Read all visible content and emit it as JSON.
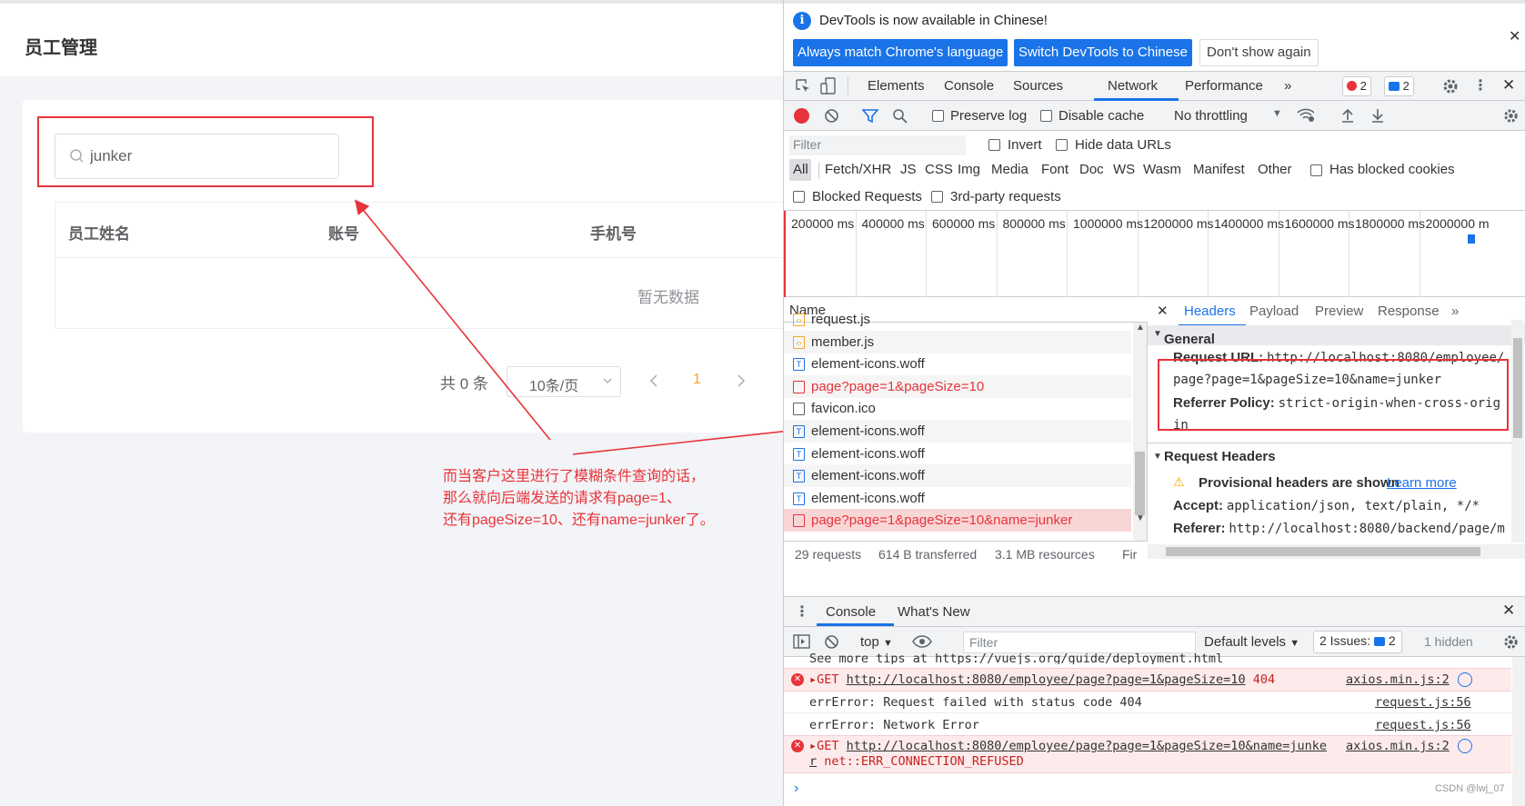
{
  "app": {
    "title": "员工管理",
    "search": {
      "value": "junker",
      "placeholder": ""
    },
    "table": {
      "columns": [
        "员工姓名",
        "账号",
        "手机号"
      ],
      "empty_text": "暂无数据"
    },
    "pagination": {
      "total": "共 0 条",
      "page_size": "10条/页",
      "current_page": "1"
    },
    "annotation": [
      "而当客户这里进行了模糊条件查询的话，",
      "那么就向后端发送的请求有page=1、",
      "还有pageSize=10、还有name=junker了。"
    ]
  },
  "devtools": {
    "banner": {
      "info": "DevTools is now available in Chinese!",
      "btn_match": "Always match Chrome's language",
      "btn_switch": "Switch DevTools to Chinese",
      "btn_dont": "Don't show again"
    },
    "tabs": [
      "Elements",
      "Console",
      "Sources",
      "Network",
      "Performance"
    ],
    "more": "»",
    "badges": {
      "errors": "2",
      "messages": "2"
    },
    "toolbar": {
      "preserve_log": "Preserve log",
      "disable_cache": "Disable cache",
      "throttling": "No throttling"
    },
    "filter": {
      "placeholder": "Filter",
      "invert": "Invert",
      "hide_data_urls": "Hide data URLs",
      "types": [
        "All",
        "Fetch/XHR",
        "JS",
        "CSS",
        "Img",
        "Media",
        "Font",
        "Doc",
        "WS",
        "Wasm",
        "Manifest",
        "Other"
      ],
      "has_blocked_cookies": "Has blocked cookies",
      "blocked_requests": "Blocked Requests",
      "third_party": "3rd-party requests"
    },
    "timeline": [
      "200000 ms",
      "400000 ms",
      "600000 ms",
      "800000 ms",
      "1000000 ms",
      "1200000 ms",
      "1400000 ms",
      "1600000 ms",
      "1800000 ms",
      "2000000 m"
    ],
    "requests": {
      "header": "Name",
      "rows": [
        {
          "name": "request.js",
          "type": "js",
          "error": false
        },
        {
          "name": "member.js",
          "type": "js",
          "error": false
        },
        {
          "name": "element-icons.woff",
          "type": "font",
          "error": false
        },
        {
          "name": "page?page=1&pageSize=10",
          "type": "xhr",
          "error": true
        },
        {
          "name": "favicon.ico",
          "type": "img",
          "error": false
        },
        {
          "name": "element-icons.woff",
          "type": "font",
          "error": false
        },
        {
          "name": "element-icons.woff",
          "type": "font",
          "error": false
        },
        {
          "name": "element-icons.woff",
          "type": "font",
          "error": false
        },
        {
          "name": "element-icons.woff",
          "type": "font",
          "error": false
        },
        {
          "name": "page?page=1&pageSize=10&name=junker",
          "type": "xhr",
          "error": true
        }
      ],
      "footer": [
        "29 requests",
        "614 B transferred",
        "3.1 MB resources",
        "Fir"
      ]
    },
    "details": {
      "tabs": [
        "Headers",
        "Payload",
        "Preview",
        "Response"
      ],
      "general": "General",
      "request_url_key": "Request URL:",
      "request_url_1": "http://localhost:8080/employee/",
      "request_url_2": "page?page=1&pageSize=10&name=junker",
      "referrer_policy_key": "Referrer Policy:",
      "referrer_policy_1": "strict-origin-when-cross-orig",
      "referrer_policy_2": "in",
      "request_headers": "Request Headers",
      "provisional": "Provisional headers are shown",
      "learn_more": "Learn more",
      "accept_key": "Accept:",
      "accept_val": "application/json, text/plain, */*",
      "referer_key": "Referer:",
      "referer_val": "http://localhost:8080/backend/page/m"
    },
    "console": {
      "tabs": [
        "Console",
        "What's New"
      ],
      "context": "top",
      "filter_placeholder": "Filter",
      "levels": "Default levels",
      "issues_label": "2 Issues:",
      "issues_count": "2",
      "hidden": "1 hidden",
      "lines": {
        "tips": "See more tips at https://vuejs.org/guide/deployment.html",
        "get1_method": "GET",
        "get1_url": "http://localhost:8080/employee/page?page=1&pageSize=10",
        "get1_status": "404",
        "get1_src": "axios.min.js:2",
        "err1": "errError: Request failed with status code 404",
        "err1_src": "request.js:56",
        "err2": "errError: Network Error",
        "err2_src": "request.js:56",
        "get2_method": "GET",
        "get2_url": "http://localhost:8080/employee/page?page=1&pageSize=10&name=junke",
        "get2_url2": "r",
        "get2_status": "net::ERR_CONNECTION_REFUSED",
        "get2_src": "axios.min.js:2"
      },
      "prompt": "›"
    },
    "watermark": "CSDN @lwj_07"
  },
  "colors": {
    "accent": "#1a73e8",
    "error": "#e8333a",
    "highlight": "#f5a623"
  }
}
